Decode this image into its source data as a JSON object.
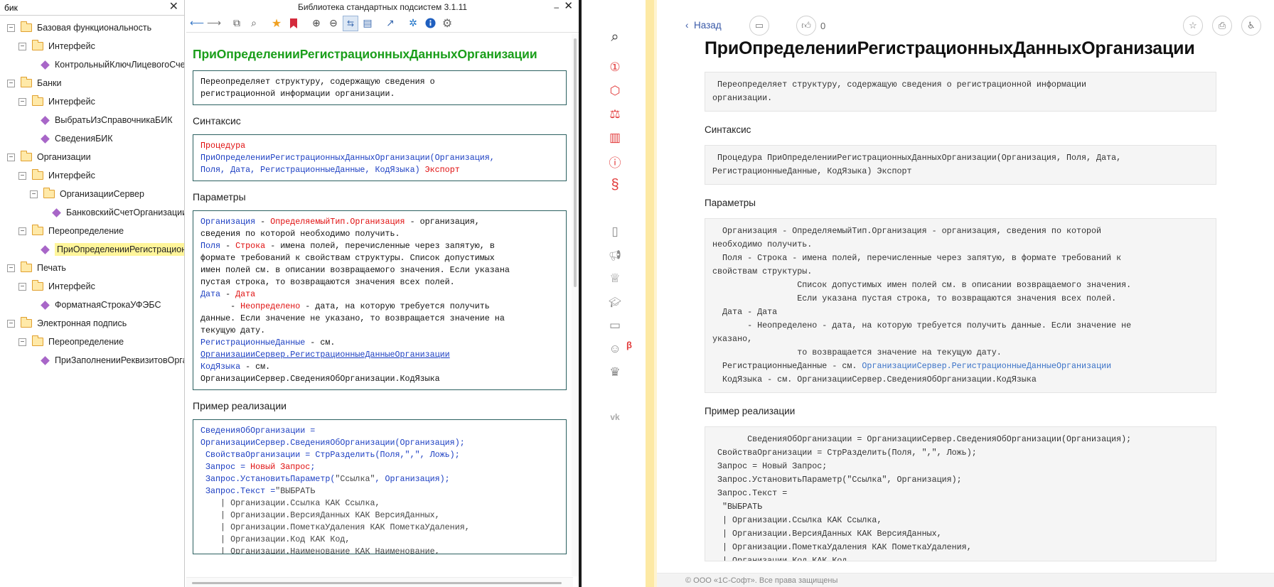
{
  "tree": {
    "search_value": "бик",
    "clear_glyph": "✕",
    "nodes": [
      {
        "label": "Базовая функциональность",
        "type": "folder",
        "level": 0
      },
      {
        "label": "Интерфейс",
        "type": "folder",
        "level": 1
      },
      {
        "label": "КонтрольныйКлючЛицевогоСчета",
        "type": "method",
        "level": 2
      },
      {
        "label": "Банки",
        "type": "folder",
        "level": 0
      },
      {
        "label": "Интерфейс",
        "type": "folder",
        "level": 1
      },
      {
        "label": "ВыбратьИзСправочникаБИК",
        "type": "method",
        "level": 2
      },
      {
        "label": "СведенияБИК",
        "type": "method",
        "level": 2
      },
      {
        "label": "Организации",
        "type": "folder",
        "level": 0
      },
      {
        "label": "Интерфейс",
        "type": "folder",
        "level": 1
      },
      {
        "label": "ОрганизацииСервер",
        "type": "folder",
        "level": 2
      },
      {
        "label": "БанковскийСчетОрганизации",
        "type": "method",
        "level": 3
      },
      {
        "label": "Переопределение",
        "type": "folder",
        "level": 1
      },
      {
        "label": "ПриОпределенииРегистрационныхДанныхОрганизации",
        "type": "method",
        "level": 2,
        "selected": true
      },
      {
        "label": "Печать",
        "type": "folder",
        "level": 0
      },
      {
        "label": "Интерфейс",
        "type": "folder",
        "level": 1
      },
      {
        "label": "ФорматнаяСтрокаУФЭБС",
        "type": "method",
        "level": 2
      },
      {
        "label": "Электронная подпись",
        "type": "folder",
        "level": 0
      },
      {
        "label": "Переопределение",
        "type": "folder",
        "level": 1
      },
      {
        "label": "ПриЗаполненииРеквизитовОрганизации",
        "type": "method",
        "level": 2
      }
    ]
  },
  "viewer": {
    "title": "Библиотека стандартных подсистем 3.1.11",
    "minimize_glyph": "–",
    "close_glyph": "✕",
    "heading": "ПриОпределенииРегистрационныхДанныхОрганизации",
    "description": "Переопределяет структуру, содержащую сведения о\nрегистрационной информации организации.",
    "syntax_heading": "Синтаксис",
    "params_heading": "Параметры",
    "example_heading": "Пример реализации",
    "syntax": {
      "kw_procedure": "Процедура",
      "name": "ПриОпределенииРегистрационныхДанныхОрганизации(Организация,",
      "args": "Поля, Дата, РегистрационныеДанные, КодЯзыка)",
      "kw_export": "Экспорт"
    },
    "params": {
      "p1_name": "Организация",
      "p1_dash": " - ",
      "p1_type": "ОпределяемыйТип.Организация",
      "p1_desc": " - организация,",
      "p1_desc2": "сведения по которой необходимо получить.",
      "p2_name": "Поля",
      "p2_type": "Строка",
      "p2_desc": " - имена полей, перечисленные через запятую, в",
      "p2_desc2": "формате требований к свойствам структуры. Список допустимых\nимен полей см. в описании возвращаемого значения. Если указана\nпустая строка, то возвращаются значения всех полей.",
      "p3_name": "Дата",
      "p3_type": "Дата",
      "p3_indent": "      - ",
      "p3_type2": "Неопределено",
      "p3_desc": " - дата, на которую требуется получить",
      "p3_desc2": "данные. Если значение не указано, то возвращается значение на\nтекущую дату.",
      "p4_name": "РегистрационныеДанные",
      "p4_desc": " - см.",
      "p4_link": "ОрганизацииСервер.РегистрационныеДанныеОрганизации",
      "p5_name": "КодЯзыка",
      "p5_desc": " - см.",
      "p5_desc2": "ОрганизацииСервер.СведенияОбОрганизации.КодЯзыка"
    },
    "example": {
      "l1": "СведенияОбОрганизации =",
      "l2": "ОрганизацииСервер.СведенияОбОрганизации(Организация);",
      "l3": " СвойстваОрганизации = СтрРазделить(Поля,\",\", Ложь);",
      "l4a": " Запрос = ",
      "l4b": "Новый Запрос",
      "l4c": ";",
      "l5a": " Запрос.УстановитьПараметр(",
      "l5b": "\"Ссылка\"",
      "l5c": ", Организация);",
      "l6a": " Запрос.Текст =",
      "l6b": "\"ВЫБРАТЬ",
      "rest": "    | Организации.Ссылка КАК Ссылка,\n    | Организации.ВерсияДанных КАК ВерсияДанных,\n    | Организации.ПометкаУдаления КАК ПометкаУдаления,\n    | Организации.Код КАК Код,\n    | Организации.Наименование КАК Наименование,\n    | Организации.БИК КАК БИК,"
    }
  },
  "iconbar": {
    "icons": [
      "search-icon",
      "1c-logo-icon",
      "puzzle-icon",
      "scales-icon",
      "books-icon",
      "info-icon",
      "paragraph-icon",
      "document-icon",
      "megaphone-icon",
      "trophy-icon",
      "graduation-cap-icon",
      "chat-icon",
      "support-agent-icon",
      "crown-icon",
      "vk-icon"
    ],
    "beta_label": "β"
  },
  "web": {
    "back_label": "Назад",
    "like_count": "0",
    "heading": "ПриОпределенииРегистрационныхДанныхОрганизации",
    "description": " Переопределяет структуру, содержащую сведения о регистрационной информации\nорганизации.",
    "syntax_heading": "Синтаксис",
    "syntax": " Процедура ПриОпределенииРегистрационныхДанныхОрганизации(Организация, Поля, Дата,\nРегистрационныеДанные, КодЯзыка) Экспорт",
    "params_heading": "Параметры",
    "params_text": "  Организация - ОпределяемыйТип.Организация - организация, сведения по которой\nнеобходимо получить.\n  Поля - Строка - имена полей, перечисленные через запятую, в формате требований к\nсвойствам структуры.\n                 Список допустимых имен полей см. в описании возвращаемого значения.\n                 Если указана пустая строка, то возвращаются значения всех полей.\n  Дата - Дата\n       - Неопределено - дата, на которую требуется получить данные. Если значение не\nуказано,\n                 то возвращается значение на текущую дату.",
    "params_reg": "  РегистрационныеДанные - см. ",
    "params_reg_link": "ОрганизацииСервер.РегистрационныеДанныеОрганизации",
    "params_lang": "  КодЯзыка - см. ОрганизацииСервер.СведенияОбОрганизации.КодЯзыка",
    "example_heading": "Пример реализации",
    "example": "       СведенияОбОрганизации = ОрганизацииСервер.СведенияОбОрганизации(Организация);\n СвойстваОрганизации = СтрРазделить(Поля, \",\", Ложь);\n Запрос = Новый Запрос;\n Запрос.УстановитьПараметр(\"Ссылка\", Организация);\n Запрос.Текст =\n  \"ВЫБРАТЬ\n  | Организации.Ссылка КАК Ссылка,\n  | Организации.ВерсияДанных КАК ВерсияДанных,\n  | Организации.ПометкаУдаления КАК ПометкаУдаления,\n  | Организации.Код КАК Код,",
    "footer": "© ООО «1С-Софт». Все права защищены"
  }
}
